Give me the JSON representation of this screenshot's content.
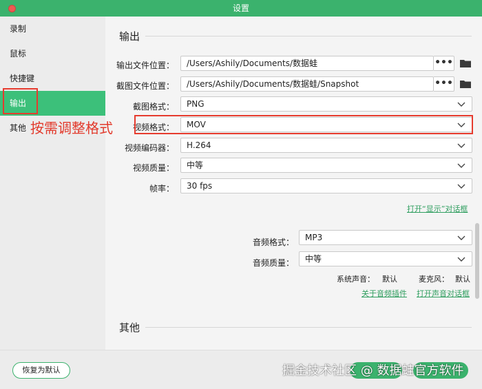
{
  "window": {
    "title": "设置"
  },
  "sidebar": {
    "items": [
      {
        "label": "录制"
      },
      {
        "label": "鼠标"
      },
      {
        "label": "快捷键"
      },
      {
        "label": "输出",
        "active": true
      },
      {
        "label": "其他"
      }
    ]
  },
  "output": {
    "section_title": "输出",
    "file_location": {
      "label": "输出文件位置：",
      "value": "/Users/Ashily/Documents/数据蛙"
    },
    "screenshot_location": {
      "label": "截图文件位置：",
      "value": "/Users/Ashily/Documents/数据蛙/Snapshot"
    },
    "screenshot_format": {
      "label": "截图格式：",
      "value": "PNG"
    },
    "video_format": {
      "label": "视频格式：",
      "value": "MOV"
    },
    "video_encoder": {
      "label": "视频编码器：",
      "value": "H.264"
    },
    "video_quality": {
      "label": "视频质量：",
      "value": "中等"
    },
    "frame_rate": {
      "label": "帧率：",
      "value": "30 fps"
    },
    "open_display_dialog": "打开“显示”对话框",
    "audio_format": {
      "label": "音频格式：",
      "value": "MP3"
    },
    "audio_quality": {
      "label": "音频质量：",
      "value": "中等"
    },
    "system_sound": {
      "label": "系统声音：",
      "value": "默认"
    },
    "microphone": {
      "label": "麦克风：",
      "value": "默认"
    },
    "about_audio_plugin": "关于音频插件",
    "open_sound_dialog": "打开声音对话框"
  },
  "other": {
    "section_title": "其他"
  },
  "annotation": {
    "text": "按需调整格式"
  },
  "footer": {
    "restore_label": "恢复为默认",
    "watermark": "掘金技术社区 @ 数据蛙官方软件"
  },
  "colors": {
    "accent": "#3bb26d",
    "annotation_red": "#e63b2e",
    "link": "#2f9e5f"
  }
}
